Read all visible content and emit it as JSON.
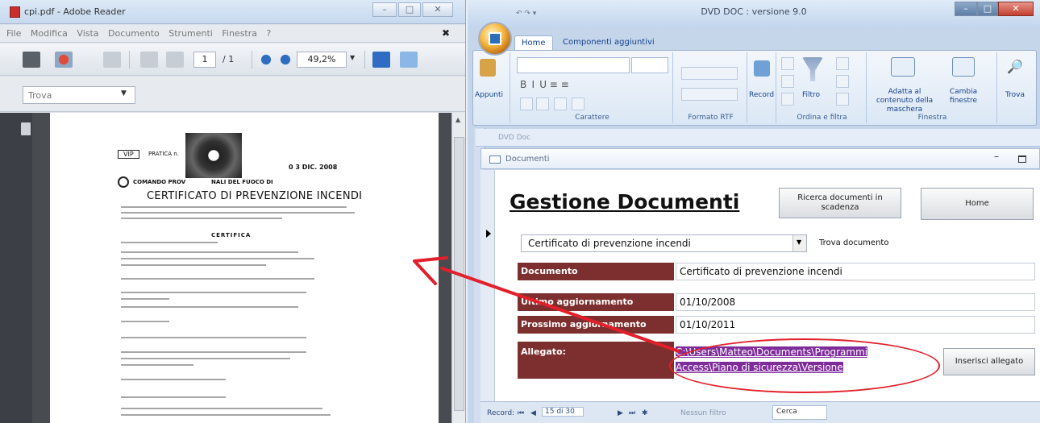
{
  "reader": {
    "title": "cpi.pdf - Adobe Reader",
    "menu": [
      "File",
      "Modifica",
      "Vista",
      "Documento",
      "Strumenti",
      "Finestra",
      "?"
    ],
    "page_current": "1",
    "page_total": "/ 1",
    "zoom": "49,2%",
    "find_placeholder": "Trova",
    "pdf": {
      "header_box": "VIP",
      "pratica": "PRATICA n.",
      "date": "0 3 DIC. 2008",
      "comando": "COMANDO PROV",
      "vigili": "NALI DEL FUOCO DI",
      "title": "CERTIFICATO DI PREVENZIONE INCENDI",
      "certifica": "CERTIFICA"
    }
  },
  "dvd": {
    "title": "DVD DOC : versione 9.0",
    "tabs": [
      "Home",
      "Componenti aggiuntivi"
    ],
    "ribbon": {
      "groups": [
        "Carattere",
        "Formato RTF",
        "Ordina e filtra",
        "Finestra"
      ],
      "appunti": "Appunti",
      "record": "Record",
      "filtro": "Filtro",
      "adatta": "Adatta al contenuto della maschera",
      "cambia": "Cambia finestre",
      "trova": "Trova"
    },
    "object_header": "DVD Doc",
    "doc_tab": "Documenti",
    "form": {
      "title": "Gestione Documenti",
      "btn_ricerca": "Ricerca documenti in scadenza",
      "btn_home": "Home",
      "combo_value": "Certificato di prevenzione incendi",
      "find_label": "Trova documento",
      "fields": [
        {
          "label": "Documento",
          "value": "Certificato di prevenzione incendi"
        },
        {
          "label": "Ultimo aggiornamento",
          "value": "01/10/2008"
        },
        {
          "label": "Prossimo aggiornamento",
          "value": "01/10/2011"
        }
      ],
      "allegato_label": "Allegato:",
      "allegato_line1": "C:\\Users\\Matteo\\Documents\\Programmi",
      "allegato_line2": "Access\\Piano di sicurezza\\Versione",
      "btn_inserisci": "Inserisci allegato"
    },
    "navbar": {
      "record_label": "Record:",
      "record_pos": "15 di 30",
      "no_filter": "Nessun filtro",
      "search": "Cerca"
    }
  },
  "colors": {
    "label_bg": "#7d2f2f",
    "attachment_highlight": "#7e2c9a",
    "annotation_red": "#e2202b",
    "ribbon_text": "#15428b"
  }
}
